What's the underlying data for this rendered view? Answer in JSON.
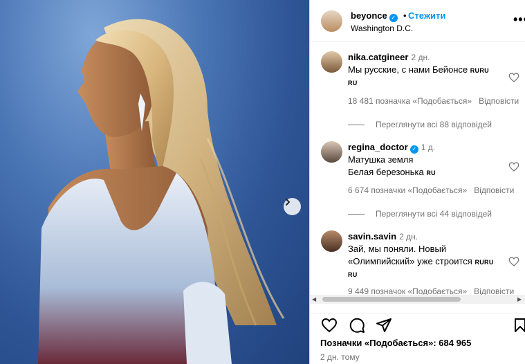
{
  "post": {
    "username": "beyonce",
    "separator": "•",
    "follow_label": "Стежити",
    "location": "Washington D.C.",
    "more_label": "•••"
  },
  "comments": [
    {
      "username": "nika.catgineer",
      "time": "2 дн.",
      "text": "Мы русские, с нами Бейонсе",
      "flags": "RURU",
      "flags2": "RU",
      "likes": "18 481 позначка «Подобається»",
      "reply": "Відповісти",
      "view_replies": "Переглянути всі 88 відповідей"
    },
    {
      "username": "regina_doctor",
      "time": "1 д.",
      "text_line1": "Матушка земля",
      "text_line2": "Белая березонька",
      "flags": "RU",
      "likes": "6 674 позначки «Подобається»",
      "reply": "Відповісти",
      "view_replies": "Переглянути всі 44 відповідей"
    },
    {
      "username": "savin.savin",
      "time": "2 дн.",
      "text_line1": "Зай, мы поняли. Новый",
      "text_line2": "«Олимпийский» уже строится",
      "flags": "RURU",
      "flags2": "RU",
      "likes": "9 449 позначок «Подобається»",
      "reply": "Відповісти"
    }
  ],
  "footer": {
    "likes": "Позначки «Подобається»: 684 965",
    "time": "2 дн. тому"
  },
  "icons": {
    "heart": "heart-icon",
    "comment": "comment-icon",
    "share": "share-icon",
    "bookmark": "bookmark-icon",
    "next": "chevron-right-icon",
    "verified": "verified-badge-icon"
  },
  "colors": {
    "link": "#0095f6",
    "muted": "#737373",
    "background": "#ffffff"
  }
}
